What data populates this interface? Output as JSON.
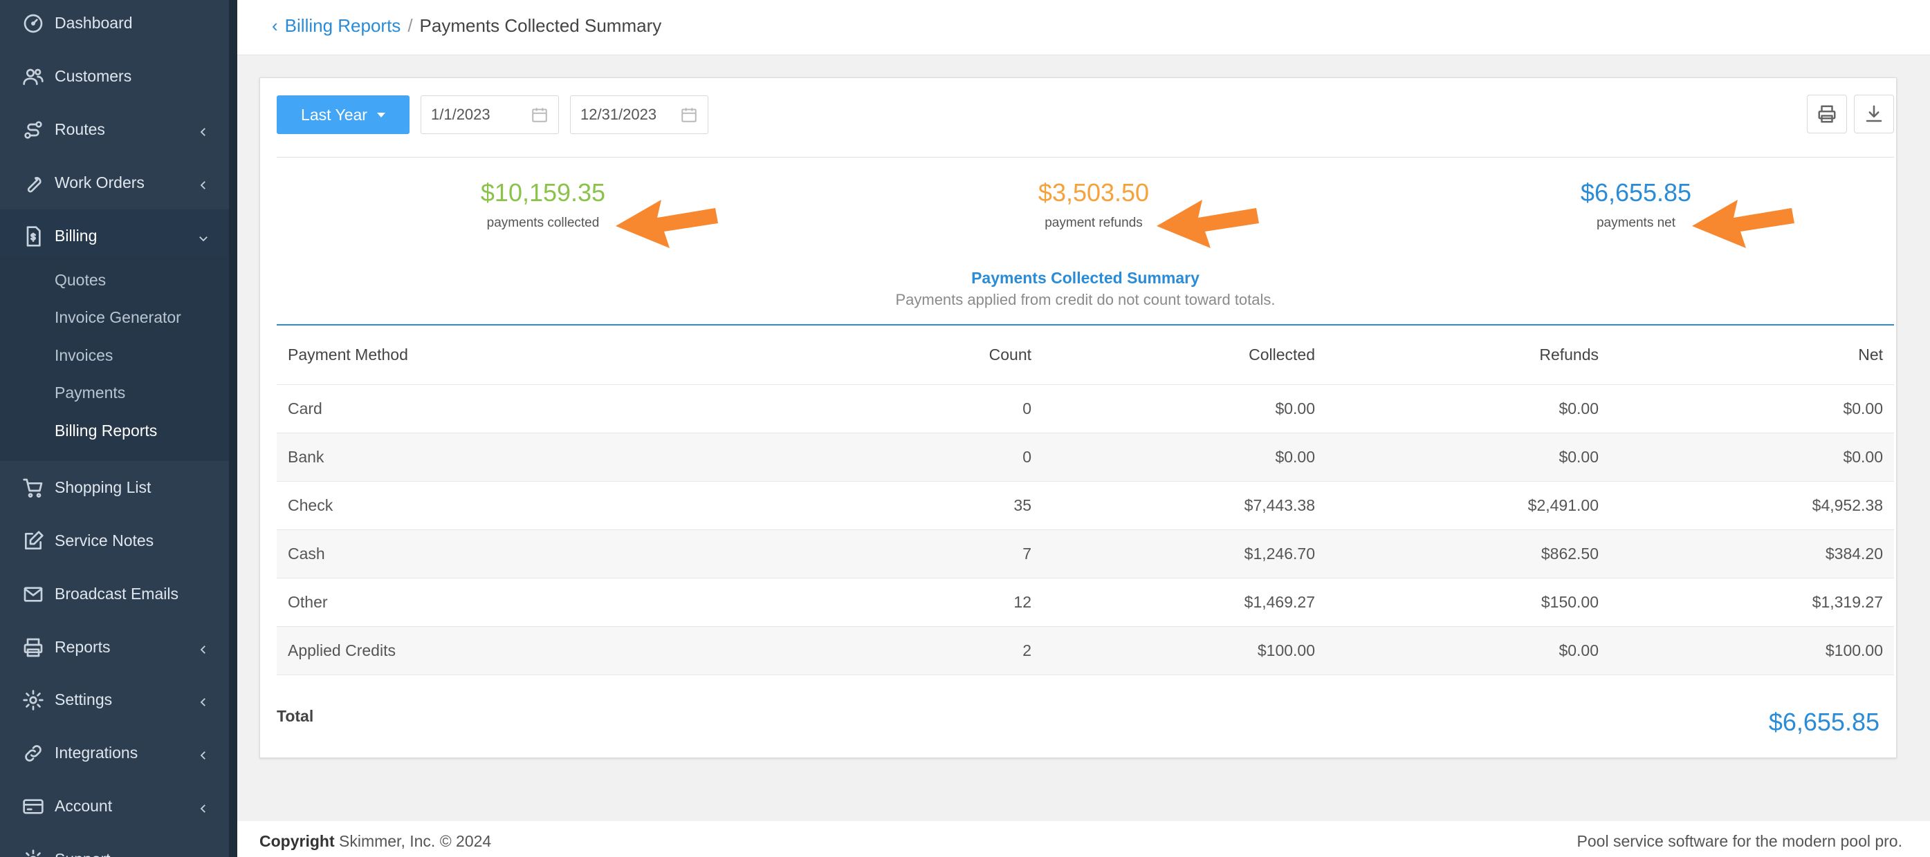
{
  "sidebar": {
    "items": [
      {
        "label": "Dashboard"
      },
      {
        "label": "Customers"
      },
      {
        "label": "Routes"
      },
      {
        "label": "Work Orders"
      },
      {
        "label": "Billing"
      },
      {
        "label": "Shopping List"
      },
      {
        "label": "Service Notes"
      },
      {
        "label": "Broadcast Emails"
      },
      {
        "label": "Reports"
      },
      {
        "label": "Settings"
      },
      {
        "label": "Integrations"
      },
      {
        "label": "Account"
      },
      {
        "label": "Support"
      }
    ],
    "billing_sub": [
      "Quotes",
      "Invoice Generator",
      "Invoices",
      "Payments",
      "Billing Reports"
    ]
  },
  "breadcrumb": {
    "parent": "Billing Reports",
    "separator": "/",
    "current": "Payments Collected Summary"
  },
  "filters": {
    "range_label": "Last Year",
    "start_date": "1/1/2023",
    "end_date": "12/31/2023"
  },
  "stats": {
    "collected_value": "$10,159.35",
    "collected_label": "payments collected",
    "refunds_value": "$3,503.50",
    "refunds_label": "payment refunds",
    "net_value": "$6,655.85",
    "net_label": "payments net"
  },
  "colors": {
    "collected": "#8bc34a",
    "refunds": "#f5a23a",
    "net": "#2a8bd6",
    "arrow": "#f7882f"
  },
  "summary": {
    "title": "Payments Collected Summary",
    "subtitle": "Payments applied from credit do not count toward totals."
  },
  "table": {
    "headers": [
      "Payment Method",
      "Count",
      "Collected",
      "Refunds",
      "Net"
    ],
    "rows": [
      [
        "Card",
        "0",
        "$0.00",
        "$0.00",
        "$0.00"
      ],
      [
        "Bank",
        "0",
        "$0.00",
        "$0.00",
        "$0.00"
      ],
      [
        "Check",
        "35",
        "$7,443.38",
        "$2,491.00",
        "$4,952.38"
      ],
      [
        "Cash",
        "7",
        "$1,246.70",
        "$862.50",
        "$384.20"
      ],
      [
        "Other",
        "12",
        "$1,469.27",
        "$150.00",
        "$1,319.27"
      ],
      [
        "Applied Credits",
        "2",
        "$100.00",
        "$0.00",
        "$100.00"
      ]
    ],
    "total_label": "Total",
    "total_value": "$6,655.85"
  },
  "footer": {
    "copyright_label": "Copyright",
    "copyright_text": " Skimmer, Inc. © 2024",
    "tagline": "Pool service software for the modern pool pro."
  }
}
